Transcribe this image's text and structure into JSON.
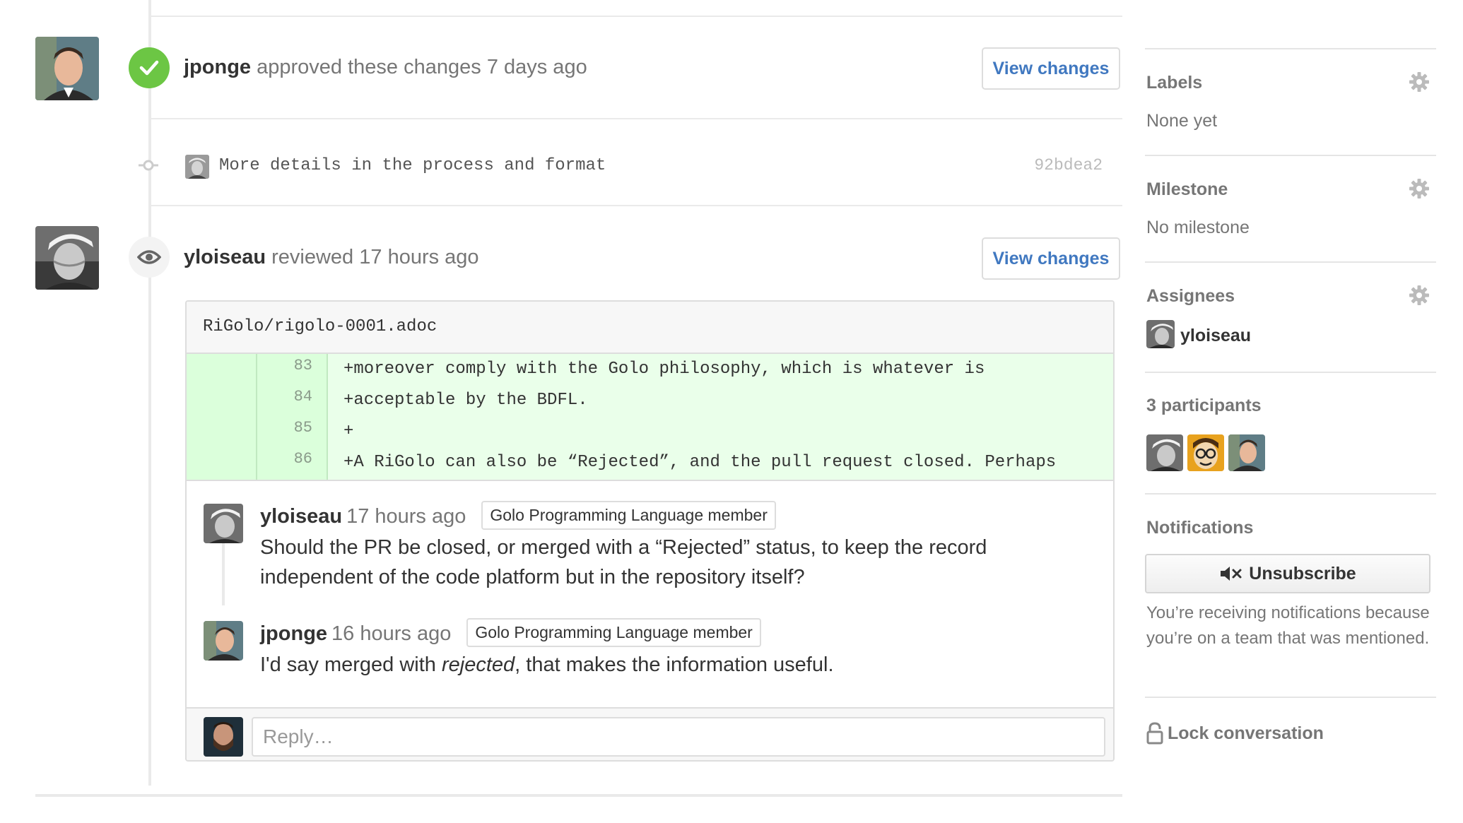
{
  "timeline": {
    "approval": {
      "user": "jponge",
      "action": "approved these changes",
      "time": "7 days ago",
      "view_changes_label": "View changes",
      "status_color": "#6cc644"
    },
    "commit": {
      "message": "More details in the process and format",
      "sha": "92bdea2"
    },
    "review": {
      "user": "yloiseau",
      "action": "reviewed",
      "time": "17 hours ago",
      "view_changes_label": "View changes",
      "file_path": "RiGolo/rigolo-0001.adoc",
      "diff_lines": [
        {
          "number": "83",
          "code": "+moreover comply with the Golo philosophy, which is whatever is"
        },
        {
          "number": "84",
          "code": "+acceptable by the BDFL."
        },
        {
          "number": "85",
          "code": "+"
        },
        {
          "number": "86",
          "code": "+A RiGolo can also be “Rejected”, and the pull request closed. Perhaps"
        }
      ],
      "comments": [
        {
          "author": "yloiseau",
          "time": "17 hours ago",
          "association": "Golo Programming Language member",
          "body": "Should the PR be closed, or merged with a “Rejected” status, to keep the record independent of the code platform but in the repository itself?"
        },
        {
          "author": "jponge",
          "time": "16 hours ago",
          "association": "Golo Programming Language member",
          "body_before": "I'd say merged with ",
          "body_em": "rejected",
          "body_after": ", that makes the information useful."
        }
      ],
      "reply_placeholder": "Reply…"
    }
  },
  "sidebar": {
    "labels": {
      "title": "Labels",
      "value": "None yet"
    },
    "milestone": {
      "title": "Milestone",
      "value": "No milestone"
    },
    "assignees": {
      "title": "Assignees",
      "users": [
        "yloiseau"
      ]
    },
    "participants": {
      "title": "3 participants"
    },
    "notifications": {
      "title": "Notifications",
      "button_label": "Unsubscribe",
      "text": "You’re receiving notifications because you’re on a team that was mentioned."
    },
    "lock": {
      "label": "Lock conversation"
    }
  },
  "colors": {
    "link": "#4078c0",
    "approved": "#6cc644",
    "diff_added_bg": "#eaffea",
    "diff_added_gutter": "#dbffdb"
  },
  "icons": [
    "check-icon",
    "eye-icon",
    "commit-icon",
    "gear-icon",
    "mute-icon",
    "lock-icon"
  ]
}
